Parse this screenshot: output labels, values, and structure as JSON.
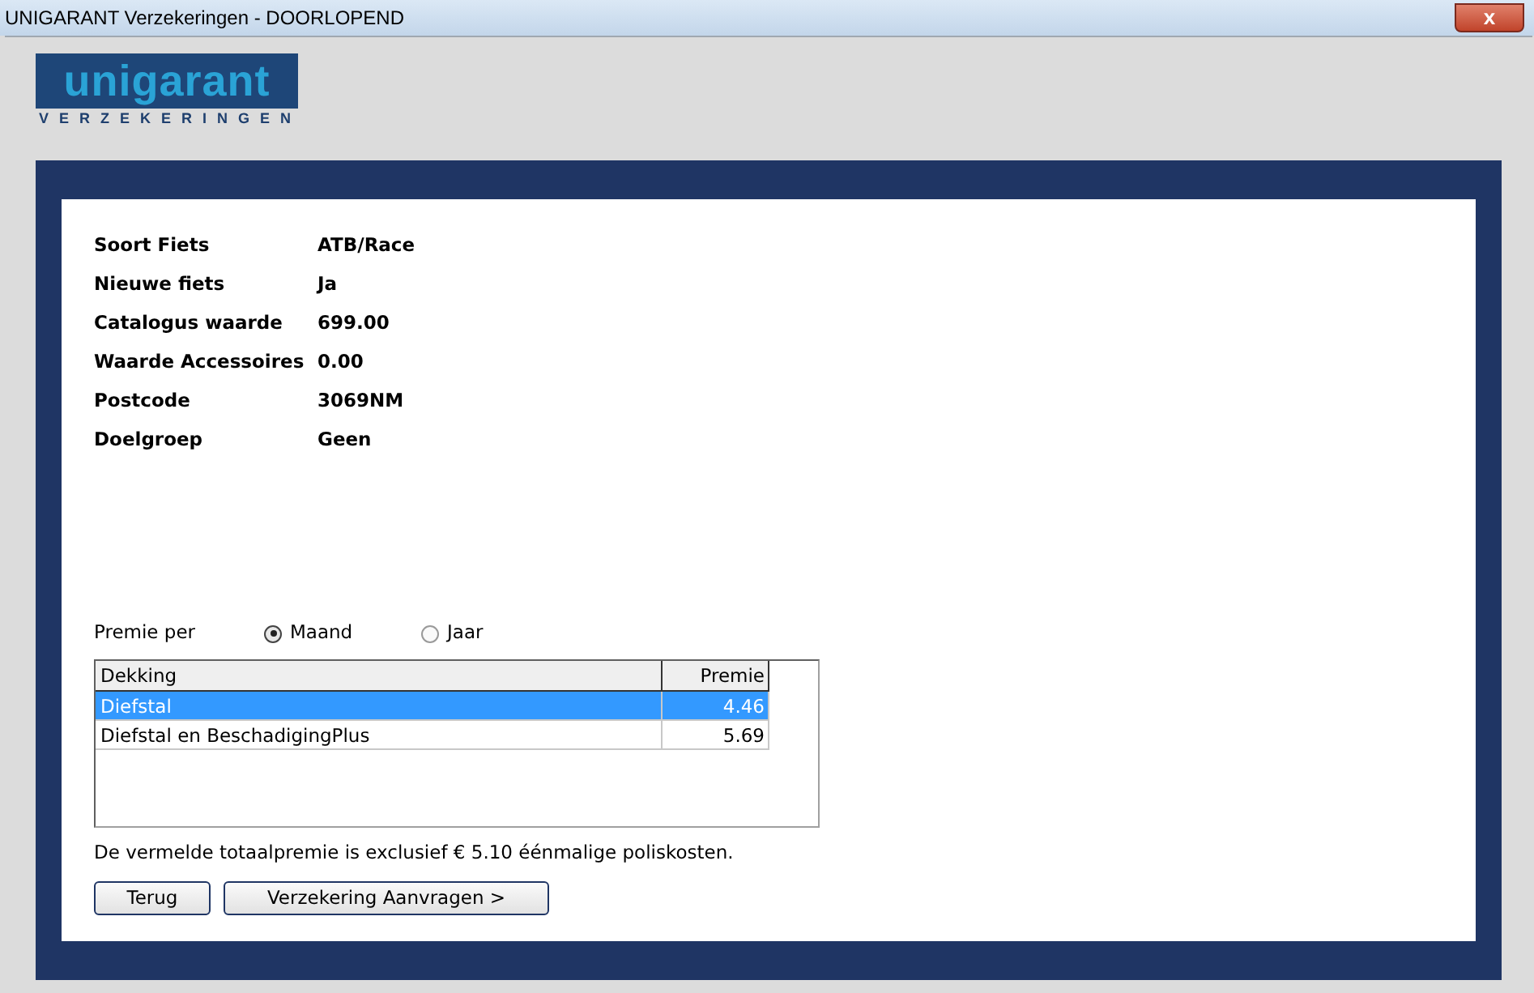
{
  "window": {
    "title": "UNIGARANT Verzekeringen - DOORLOPEND",
    "close": "x"
  },
  "logo": {
    "name": "unigarant",
    "tagline": "VERZEKERINGEN"
  },
  "details": [
    {
      "label": "Soort Fiets",
      "value": "ATB/Race"
    },
    {
      "label": "Nieuwe fiets",
      "value": "Ja"
    },
    {
      "label": "Catalogus waarde",
      "value": "699.00"
    },
    {
      "label": "Waarde Accessoires",
      "value": "0.00"
    },
    {
      "label": "Postcode",
      "value": "3069NM"
    },
    {
      "label": "Doelgroep",
      "value": "Geen"
    }
  ],
  "premium_period": {
    "label": "Premie per",
    "options": [
      {
        "label": "Maand",
        "selected": true
      },
      {
        "label": "Jaar",
        "selected": false
      }
    ]
  },
  "table": {
    "columns": [
      "Dekking",
      "Premie"
    ],
    "rows": [
      {
        "cells": [
          "Diefstal",
          "4.46"
        ],
        "selected": true
      },
      {
        "cells": [
          "Diefstal en BeschadigingPlus",
          "5.69"
        ],
        "selected": false
      }
    ]
  },
  "note": "De vermelde totaalpremie is exclusief € 5.10 éénmalige poliskosten.",
  "buttons": [
    "Terug",
    "Verzekering Aanvragen >"
  ]
}
